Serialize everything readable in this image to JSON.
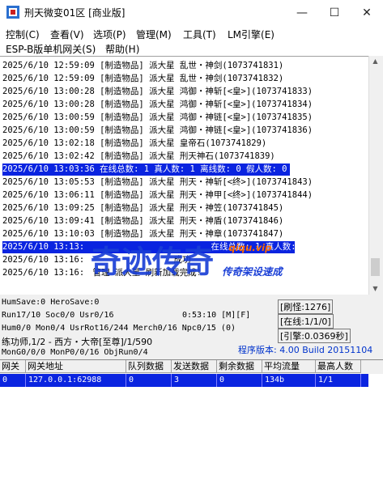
{
  "window": {
    "title": "刑天微变01区 [商业版]",
    "minimize": "—",
    "maximize": "☐",
    "close": "✕"
  },
  "menu": [
    "控制(C)",
    "查看(V)",
    "选项(P)",
    "管理(M)",
    "工具(T)",
    "LM引擎(E)",
    "ESP-B版单机网关(S)",
    "帮助(H)"
  ],
  "log": [
    "2025/6/10 12:59:09 [制造物品] 派大星 乱世・神剑(1073741831)",
    "2025/6/10 12:59:09 [制造物品] 派大星 乱世・神剑(1073741832)",
    "2025/6/10 13:00:28 [制造物品] 派大星 鸿御・神斩[<皇>](1073741833)",
    "2025/6/10 13:00:28 [制造物品] 派大星 鸿御・神斩[<皇>](1073741834)",
    "2025/6/10 13:00:59 [制造物品] 派大星 鸿御・神链[<皇>](1073741835)",
    "2025/6/10 13:00:59 [制造物品] 派大星 鸿御・神链[<皇>](1073741836)",
    "2025/6/10 13:02:18 [制造物品] 派大星 皇帝石(1073741829)",
    "2025/6/10 13:02:42 [制造物品] 派大星 刑天神石(1073741839)",
    "2025/6/10 13:03:36 在线总数: 1 真人数: 1 离线数: 0 假人数: 0",
    "2025/6/10 13:05:53 [制造物品] 派大星 刑天・神斩[<终>](1073741843)",
    "2025/6/10 13:06:11 [制造物品] 派大星 刑天・神甲[<终>](1073741844)",
    "2025/6/10 13:09:25 [制造物品] 派大星 刑天・神笠(1073741845)",
    "2025/6/10 13:09:41 [制造物品] 派大星 刑天・神盾(1073741846)",
    "2025/6/10 13:10:03 [制造物品] 派大星 刑天・神章(1073741847)",
    "2025/6/10 13:13:",
    "2025/6/10 13:16:",
    "2025/6/10 13:16:"
  ],
  "log_suffix": {
    "line14": "在线总数: 1 真人数: 1 离线数: 0 假人数: 0",
    "line15": "成功",
    "line16": "管理 派大星 刷新加载完成!"
  },
  "status": {
    "humsave": "HumSave:0 HeroSave:0",
    "run": "Run17/10 Soc0/0 Usr0/16",
    "time": "0:53:10 [M][F]",
    "hum": "Hum0/0 Mon0/4 UsrRot16/244 Merch0/16 Npc0/15 (0)",
    "map": "练功师,1/2 - 西方・大帝[至尊]/1/590",
    "mon": "MonG0/0/0 MonP0/0/16 ObjRun0/4",
    "refresh": "[刷怪:1276]",
    "online": "[在线:1/1/0]",
    "engine": "[引擎:0.0369秒]",
    "version": "程序版本: 4.00 Build 20151104"
  },
  "grid": {
    "headers": [
      "网关",
      "网关地址",
      "队列数据",
      "发送数据",
      "剩余数据",
      "平均流量",
      "最高人数"
    ],
    "rows": [
      [
        "0",
        "127.0.0.1:62988",
        "0",
        "3",
        "0",
        "134b",
        "1/1"
      ]
    ]
  },
  "watermark": {
    "main": "奇迹传奇",
    "sub": "传奇架设速成",
    "url": "qiqu.vip"
  },
  "colors": {
    "selection": "#0a24e0",
    "version": "#0033cc",
    "watermark": "#1a3fd6"
  },
  "icons": {
    "app": "app-icon",
    "scroll_up": "scroll-up-arrow-icon",
    "scroll_down": "scroll-down-arrow-icon"
  }
}
